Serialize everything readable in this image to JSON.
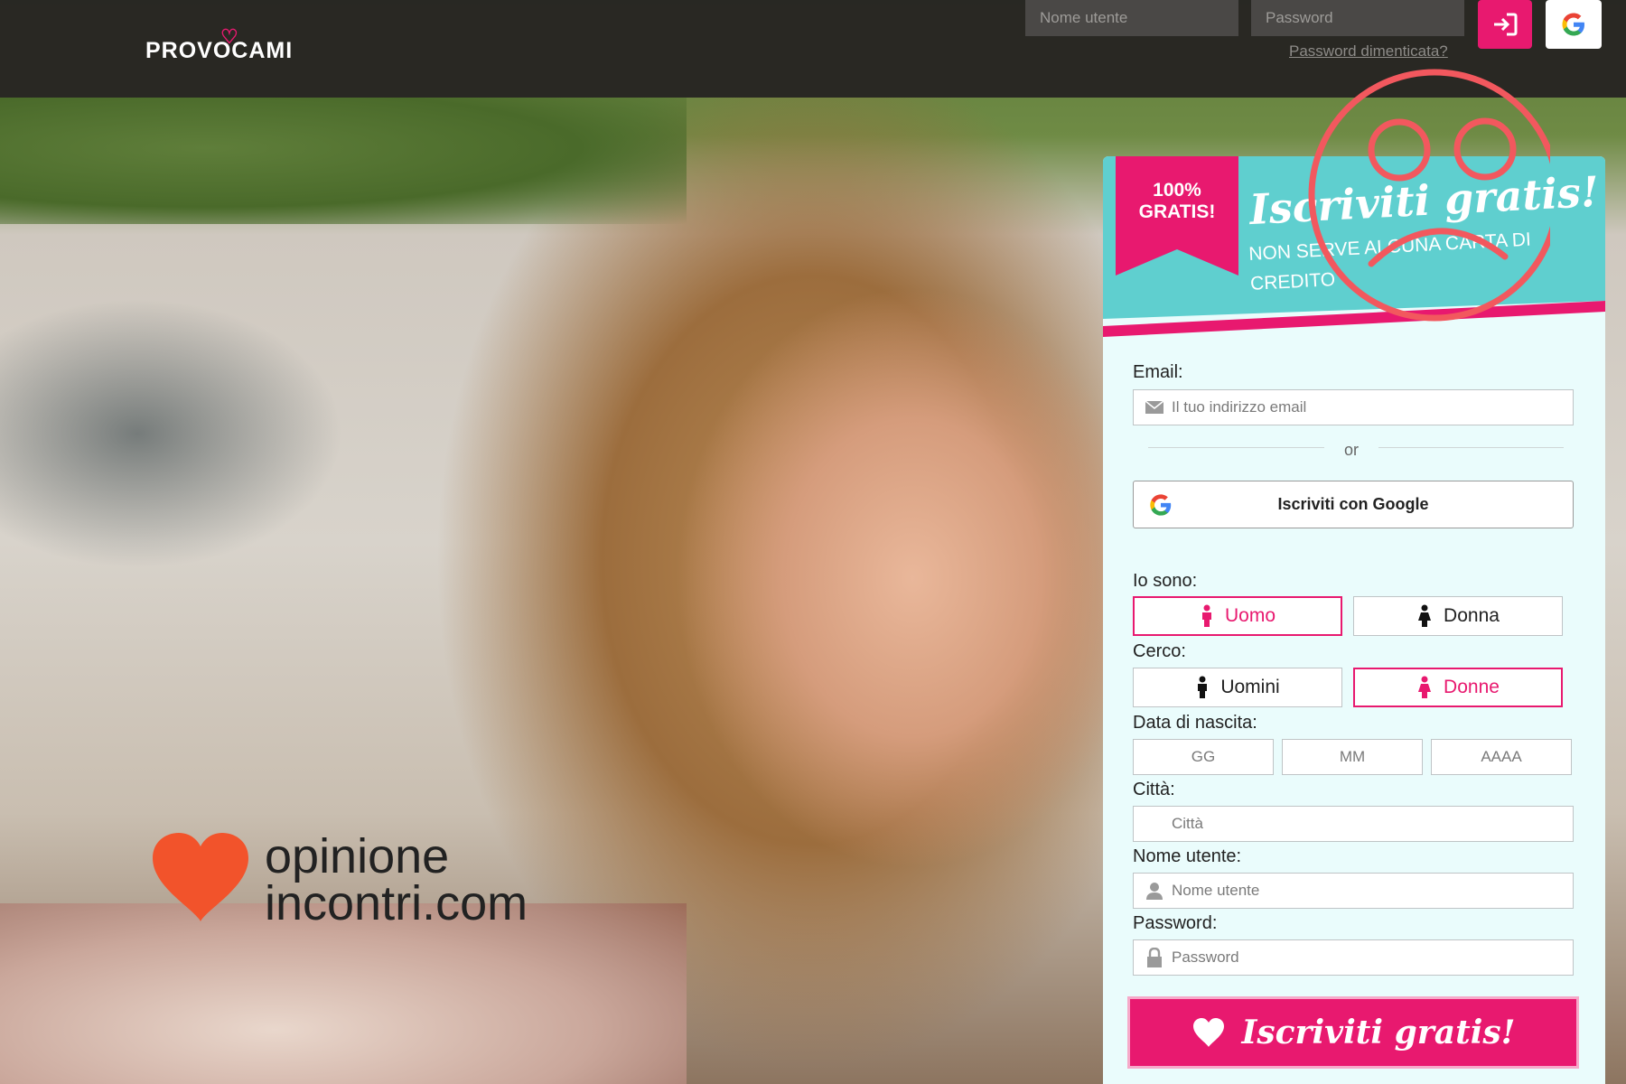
{
  "header": {
    "logo": "PROVOCAMI",
    "username_placeholder": "Nome utente",
    "password_placeholder": "Password",
    "forgot_password": "Password dimenticata?"
  },
  "watermark": {
    "line1": "opinione",
    "line2": "incontri.com"
  },
  "signup": {
    "ribbon": "100% GRATIS!",
    "title": "Iscriviti gratis!",
    "subtitle": "NON SERVE ALCUNA CARTA DI CREDITO",
    "email_label": "Email:",
    "email_placeholder": "Il tuo indirizzo email",
    "or": "or",
    "google_button": "Iscriviti con Google",
    "i_am_label": "Io sono:",
    "i_am_options": [
      "Uomo",
      "Donna"
    ],
    "seeking_label": "Cerco:",
    "seeking_options": [
      "Uomini",
      "Donne"
    ],
    "birthdate_label": "Data di nascita:",
    "day_placeholder": "GG",
    "month_placeholder": "MM",
    "year_placeholder": "AAAA",
    "city_label": "Città:",
    "city_placeholder": "Città",
    "username_label": "Nome utente:",
    "username_placeholder": "Nome utente",
    "password_label": "Password:",
    "password_placeholder": "Password",
    "submit": "Iscriviti gratis!"
  },
  "colors": {
    "accent": "#e8196f",
    "panel_head": "#5fcfcf",
    "panel_bg": "#eafcfc",
    "header_bg": "#262422",
    "watermark_heart": "#f2532b",
    "sad_face": "#f2585e"
  },
  "icons": [
    "login-arrow-icon",
    "google-icon",
    "envelope-icon",
    "person-icon",
    "lock-icon",
    "heart-icon",
    "male-icon",
    "female-icon"
  ]
}
